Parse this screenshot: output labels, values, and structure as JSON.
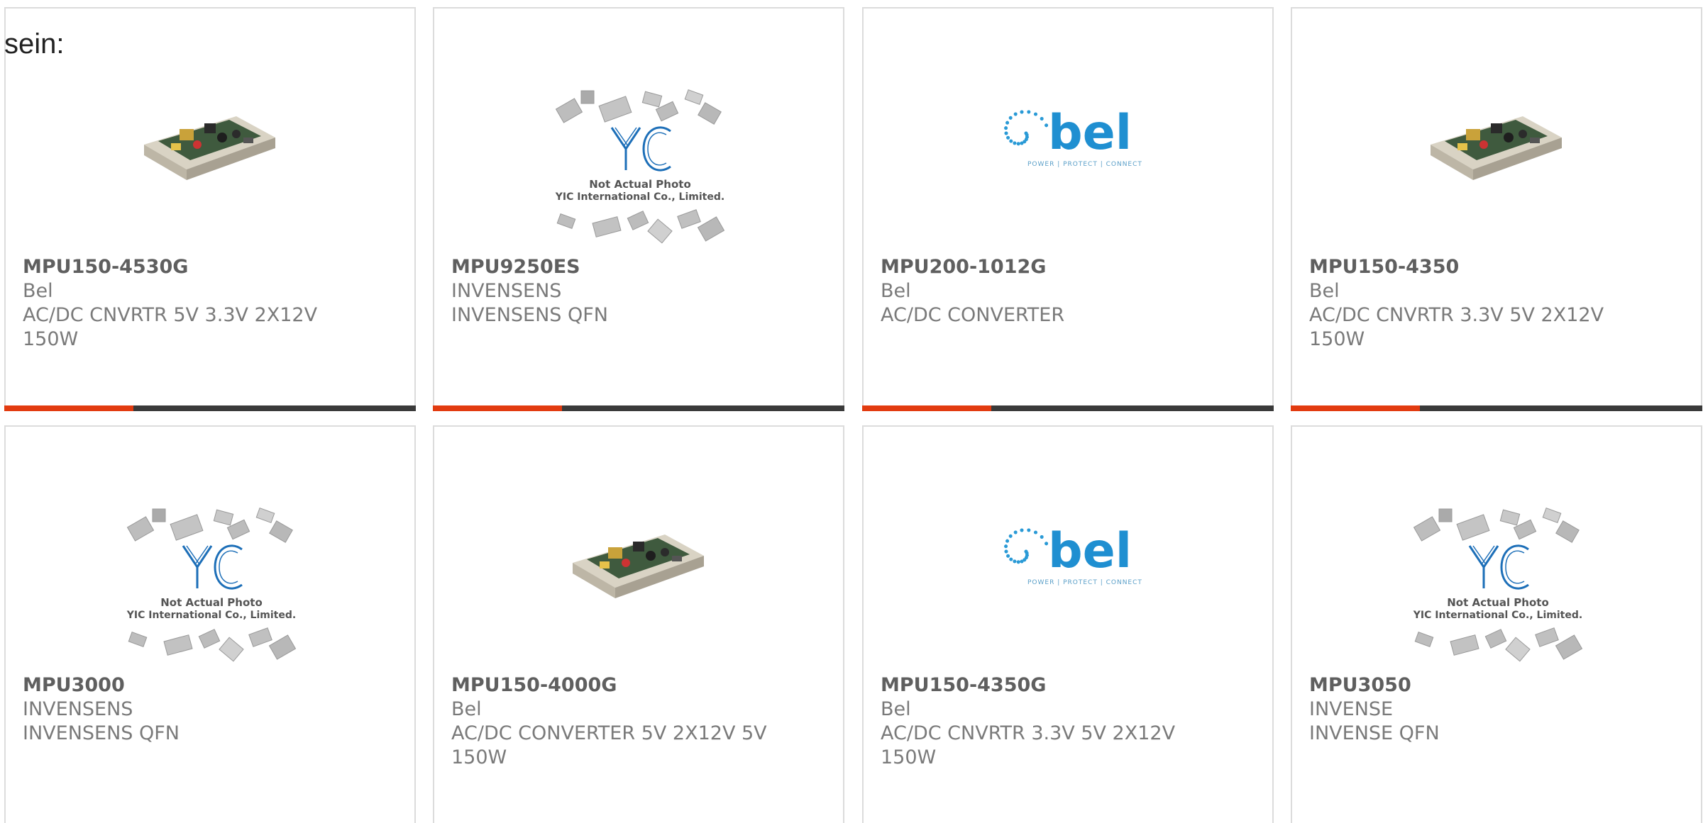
{
  "intro_text": "sein:",
  "colors": {
    "accent": "#e23b10",
    "bar": "#3a3a3a",
    "bel_blue": "#1f8fd1"
  },
  "products": [
    {
      "pn": "MPU150-4530G",
      "maker": "Bel",
      "desc": "AC/DC CNVRTR 5V 3.3V 2X12V",
      "desc2": "150W",
      "image": "power-supply-photo"
    },
    {
      "pn": "MPU9250ES",
      "maker": "INVENSENS",
      "desc": "INVENSENS QFN",
      "desc2": "",
      "image": "yic-placeholder",
      "placeholder_line1": "Not Actual Photo",
      "placeholder_line2": "YIC International Co., Limited."
    },
    {
      "pn": "MPU200-1012G",
      "maker": "Bel",
      "desc": "AC/DC CONVERTER",
      "desc2": "",
      "image": "bel-logo",
      "logo_text": "bel",
      "logo_tagline": "POWER | PROTECT | CONNECT"
    },
    {
      "pn": "MPU150-4350",
      "maker": "Bel",
      "desc": "AC/DC CNVRTR 3.3V 5V 2X12V",
      "desc2": "150W",
      "image": "power-supply-photo"
    },
    {
      "pn": "MPU3000",
      "maker": "INVENSENS",
      "desc": "INVENSENS QFN",
      "desc2": "",
      "image": "yic-placeholder",
      "placeholder_line1": "Not Actual Photo",
      "placeholder_line2": "YIC International Co., Limited."
    },
    {
      "pn": "MPU150-4000G",
      "maker": "Bel",
      "desc": "AC/DC CONVERTER 5V 2X12V 5V",
      "desc2": "150W",
      "image": "power-supply-photo"
    },
    {
      "pn": "MPU150-4350G",
      "maker": "Bel",
      "desc": "AC/DC CNVRTR 3.3V 5V 2X12V",
      "desc2": "150W",
      "image": "bel-logo",
      "logo_text": "bel",
      "logo_tagline": "POWER | PROTECT | CONNECT"
    },
    {
      "pn": "MPU3050",
      "maker": "INVENSE",
      "desc": "INVENSE QFN",
      "desc2": "",
      "image": "yic-placeholder",
      "placeholder_line1": "Not Actual Photo",
      "placeholder_line2": "YIC International Co., Limited."
    }
  ]
}
